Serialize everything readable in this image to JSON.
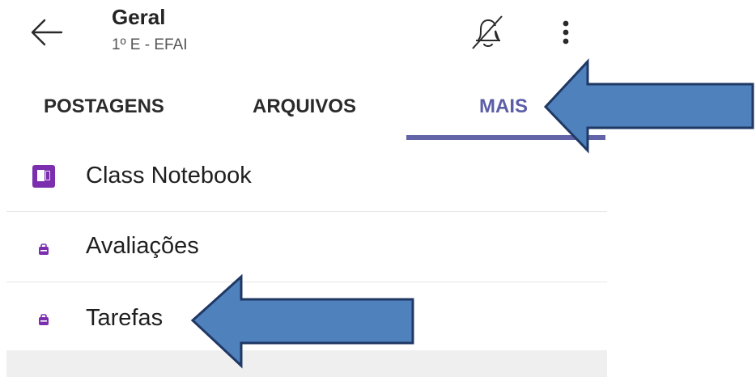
{
  "header": {
    "title": "Geral",
    "subtitle": "1º E - EFAI",
    "back_icon": "arrow-left-icon",
    "bell_icon": "bell-off-icon",
    "more_icon": "more-vertical-icon"
  },
  "tabs": [
    {
      "label": "POSTAGENS",
      "active": false
    },
    {
      "label": "ARQUIVOS",
      "active": false
    },
    {
      "label": "MAIS",
      "active": true
    }
  ],
  "items": [
    {
      "label": "Class Notebook",
      "icon": "onenote-icon"
    },
    {
      "label": "Avaliações",
      "icon": "assignments-icon"
    },
    {
      "label": "Tarefas",
      "icon": "assignments-icon"
    }
  ],
  "colors": {
    "accent": "#6264a7",
    "onenote": "#7b2fae",
    "arrow_fill": "#4f81bd",
    "arrow_stroke": "#1f3864"
  }
}
